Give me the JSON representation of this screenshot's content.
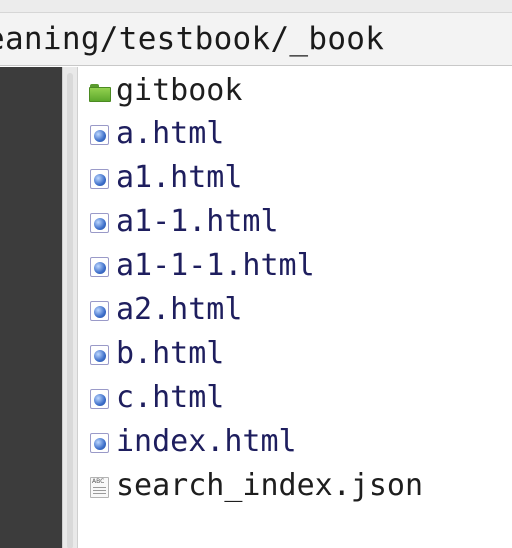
{
  "path_bar": {
    "path": "eaning/testbook/_book"
  },
  "files": [
    {
      "name": "gitbook",
      "icon": "folder-icon",
      "selected": false
    },
    {
      "name": "a.html",
      "icon": "html-file-icon",
      "selected": true
    },
    {
      "name": "a1.html",
      "icon": "html-file-icon",
      "selected": true
    },
    {
      "name": "a1-1.html",
      "icon": "html-file-icon",
      "selected": true
    },
    {
      "name": "a1-1-1.html",
      "icon": "html-file-icon",
      "selected": true
    },
    {
      "name": "a2.html",
      "icon": "html-file-icon",
      "selected": true
    },
    {
      "name": "b.html",
      "icon": "html-file-icon",
      "selected": true
    },
    {
      "name": "c.html",
      "icon": "html-file-icon",
      "selected": true
    },
    {
      "name": "index.html",
      "icon": "html-file-icon",
      "selected": true
    },
    {
      "name": "search_index.json",
      "icon": "text-file-icon",
      "selected": false
    }
  ],
  "colors": {
    "selection_fill": "#b9b9f4",
    "selection_border": "#dd1a1a",
    "left_pane": "#3c3c3c"
  }
}
